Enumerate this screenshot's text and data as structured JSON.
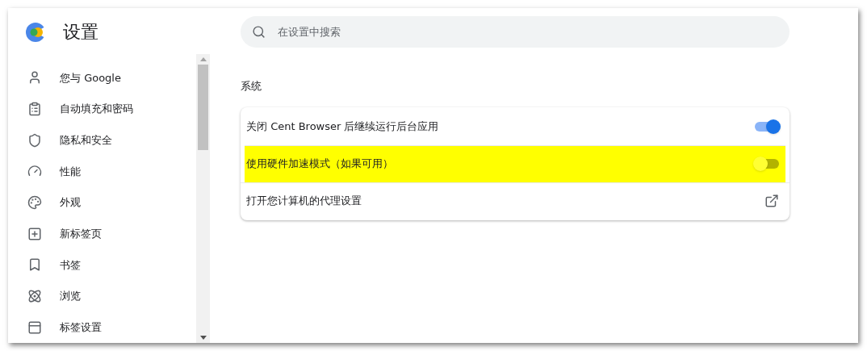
{
  "header": {
    "title": "设置"
  },
  "search": {
    "placeholder": "在设置中搜索"
  },
  "sidebar": {
    "items": [
      {
        "label": "您与 Google",
        "selected": false
      },
      {
        "label": "自动填充和密码",
        "selected": false
      },
      {
        "label": "隐私和安全",
        "selected": false
      },
      {
        "label": "性能",
        "selected": false
      },
      {
        "label": "外观",
        "selected": false
      },
      {
        "label": "新标签页",
        "selected": false
      },
      {
        "label": "书签",
        "selected": false
      },
      {
        "label": "浏览",
        "selected": false
      },
      {
        "label": "标签设置",
        "selected": false
      }
    ]
  },
  "section": {
    "title": "系统",
    "rows": [
      {
        "kind": "toggle",
        "label": "关闭 Cent Browser 后继续运行后台应用",
        "on": true,
        "highlighted": false
      },
      {
        "kind": "toggle",
        "label": "使用硬件加速模式（如果可用）",
        "on": false,
        "highlighted": true
      },
      {
        "kind": "link",
        "label": "打开您计算机的代理设置",
        "highlighted": false
      }
    ]
  }
}
